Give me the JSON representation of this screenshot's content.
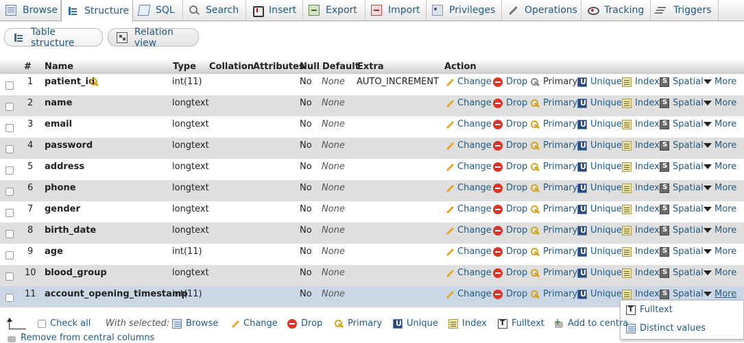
{
  "tabs": [
    {
      "label": "Browse",
      "icon": "browse-icon"
    },
    {
      "label": "Structure",
      "icon": "structure-icon"
    },
    {
      "label": "SQL",
      "icon": "sql-icon"
    },
    {
      "label": "Search",
      "icon": "search-icon"
    },
    {
      "label": "Insert",
      "icon": "insert-icon"
    },
    {
      "label": "Export",
      "icon": "export-icon"
    },
    {
      "label": "Import",
      "icon": "import-icon"
    },
    {
      "label": "Privileges",
      "icon": "privileges-icon"
    },
    {
      "label": "Operations",
      "icon": "operations-icon"
    },
    {
      "label": "Tracking",
      "icon": "tracking-icon"
    },
    {
      "label": "Triggers",
      "icon": "triggers-icon"
    }
  ],
  "active_tab": "Structure",
  "subtabs": {
    "table_structure": "Table structure",
    "relation_view": "Relation view"
  },
  "columns": {
    "num": "#",
    "name": "Name",
    "type": "Type",
    "collation": "Collation",
    "attributes": "Attributes",
    "null": "Null",
    "default": "Default",
    "extra": "Extra",
    "action": "Action"
  },
  "actions": {
    "change": "Change",
    "drop": "Drop",
    "primary": "Primary",
    "unique": "Unique",
    "index": "Index",
    "spatial": "Spatial",
    "more": "More"
  },
  "rows": [
    {
      "num": "1",
      "name": "patient_id",
      "type": "int(11)",
      "null": "No",
      "default": "None",
      "extra": "AUTO_INCREMENT"
    },
    {
      "num": "2",
      "name": "name",
      "type": "longtext",
      "null": "No",
      "default": "None",
      "extra": ""
    },
    {
      "num": "3",
      "name": "email",
      "type": "longtext",
      "null": "No",
      "default": "None",
      "extra": ""
    },
    {
      "num": "4",
      "name": "password",
      "type": "longtext",
      "null": "No",
      "default": "None",
      "extra": ""
    },
    {
      "num": "5",
      "name": "address",
      "type": "longtext",
      "null": "No",
      "default": "None",
      "extra": ""
    },
    {
      "num": "6",
      "name": "phone",
      "type": "longtext",
      "null": "No",
      "default": "None",
      "extra": ""
    },
    {
      "num": "7",
      "name": "gender",
      "type": "longtext",
      "null": "No",
      "default": "None",
      "extra": ""
    },
    {
      "num": "8",
      "name": "birth_date",
      "type": "longtext",
      "null": "No",
      "default": "None",
      "extra": ""
    },
    {
      "num": "9",
      "name": "age",
      "type": "int(11)",
      "null": "No",
      "default": "None",
      "extra": ""
    },
    {
      "num": "10",
      "name": "blood_group",
      "type": "longtext",
      "null": "No",
      "default": "None",
      "extra": ""
    },
    {
      "num": "11",
      "name": "account_opening_timestamp",
      "type": "int(11)",
      "null": "No",
      "default": "None",
      "extra": ""
    }
  ],
  "dropdown": {
    "fulltext": "Fulltext",
    "distinct_values": "Distinct values"
  },
  "footer": {
    "check_all": "Check all",
    "with_selected": "With selected:",
    "browse": "Browse",
    "change": "Change",
    "drop": "Drop",
    "primary": "Primary",
    "unique": "Unique",
    "index": "Index",
    "fulltext": "Fulltext",
    "add_to_central": "Add to centra",
    "remove_from_central": "Remove from central columns"
  },
  "colors": {
    "link": "#235a81",
    "row_alt": "#dfdfdf",
    "row_highlight": "#ccd7e6",
    "drop_red": "#d9362b"
  }
}
